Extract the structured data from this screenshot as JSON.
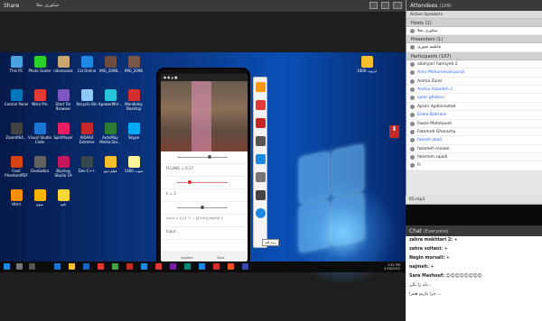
{
  "share": {
    "title": "Share",
    "presenter": "شکوری بجلا",
    "winbtns": [
      "screen-icon",
      "fullscreen-icon",
      "menu-icon"
    ]
  },
  "desktop": {
    "icons": [
      {
        "label": "This PC",
        "color": "#4aa3df"
      },
      {
        "label": "Photo Scaler",
        "color": "#2bd12b"
      },
      {
        "label": "ndomosaic",
        "color": "#c9a66b"
      },
      {
        "label": "CLI Online",
        "color": "#1e88e5"
      },
      {
        "label": "IMG_2098...",
        "color": "#6d4c41"
      },
      {
        "label": "IMG_2098",
        "color": "#795548"
      },
      {
        "label": "Control Panel",
        "color": "#0277bd"
      },
      {
        "label": "Nitro Pro",
        "color": "#e53935"
      },
      {
        "label": "Start Tor Browser",
        "color": "#7e57c2"
      },
      {
        "label": "Recycle Bin",
        "color": "#90caf9"
      },
      {
        "label": "ApowerMirr...",
        "color": "#26c6da"
      },
      {
        "label": "Mendeley Desktop",
        "color": "#d32f2f"
      },
      {
        "label": "ZoomIt64...",
        "color": "#424242"
      },
      {
        "label": "Visual Studio Code",
        "color": "#1976d2"
      },
      {
        "label": "SpotPlayer",
        "color": "#e91e63"
      },
      {
        "label": "AIDA64 Extreme",
        "color": "#c62828"
      },
      {
        "label": "AutoPlay Media Stu...",
        "color": "#2e7d32"
      },
      {
        "label": "Skype",
        "color": "#03a9f4"
      },
      {
        "label": "Foxit PhantomPDF",
        "color": "#d84315"
      },
      {
        "label": "GeoGebra",
        "color": "#616161"
      },
      {
        "label": "Bijoring Studio 19",
        "color": "#c2185b"
      },
      {
        "label": "Dev-C++",
        "color": "#37474f"
      },
      {
        "label": "فیلم دوم",
        "color": "#fbc02d"
      },
      {
        "label": "صوت 1400",
        "color": "#fff59d"
      },
      {
        "label": "Html",
        "color": "#ff8f00"
      },
      {
        "label": "سوم",
        "color": "#ffb300"
      },
      {
        "label": "ثانیه",
        "color": "#fdd835"
      }
    ],
    "tray": {
      "time": "3:42 PM",
      "date": "2/16/2022"
    },
    "folder_label": "ایروپ 1400"
  },
  "phone": {
    "sliders": [
      {
        "label": "FILLING = 0.17"
      },
      {
        "label": "k = 2"
      },
      {
        "label": "r(x,c) = {[ (1 + ... ]/(1+k)] cos(5t) ]"
      }
    ],
    "input_label": "Input...",
    "nav": [
      "Algebra",
      "Tools"
    ]
  },
  "tooltip": "رسم قلم",
  "attendees": {
    "title": "Attendees",
    "count": "(109)",
    "active_speakers": "Active Speakers",
    "hosts_header": "Hosts (1)",
    "host_name": "شکوری بجلا",
    "presenters_header": "Presenters (1)",
    "presenter_name": "فاطمه نجوری",
    "participants_header": "Participants (107)",
    "participants": [
      {
        "name": "allahyari hamiyeh 2",
        "link": false
      },
      {
        "name": "Amir Mohammad parizi",
        "link": true
      },
      {
        "name": "Arshia Zarei",
        "link": false
      },
      {
        "name": "Arshia Alizadeh 2",
        "link": true
      },
      {
        "name": "aylar ghobari",
        "link": true
      },
      {
        "name": "Aysan Aydinnezhat",
        "link": false
      },
      {
        "name": "Elahe Bahraini",
        "link": true
      },
      {
        "name": "Faeze Mahmoudi",
        "link": false
      },
      {
        "name": "Fatemeh Ghorashy",
        "link": false
      },
      {
        "name": "faezeh jalali",
        "link": true
      },
      {
        "name": "fatemeh molaei",
        "link": false
      },
      {
        "name": "fatemeh sajadi",
        "link": false
      },
      {
        "name": "Fr",
        "link": false
      }
    ]
  },
  "media": {
    "file": "65.mp3"
  },
  "chat": {
    "title": "Chat",
    "audience": "(Everyone)",
    "messages": [
      {
        "from": "zahra mokhtari 2:",
        "text": "+"
      },
      {
        "from": "zahra soltani:",
        "text": "+"
      },
      {
        "from": "Negin morsali:",
        "text": "+"
      },
      {
        "from": "najmeh:",
        "text": "+"
      },
      {
        "from": "Sara Mashouf:",
        "text": "☺☺☺☺☺☺☺☺"
      },
      {
        "from": "",
        "text": "بله را بگی..."
      },
      {
        "from": "",
        "text": "چرا داریم همرا ..."
      }
    ]
  }
}
